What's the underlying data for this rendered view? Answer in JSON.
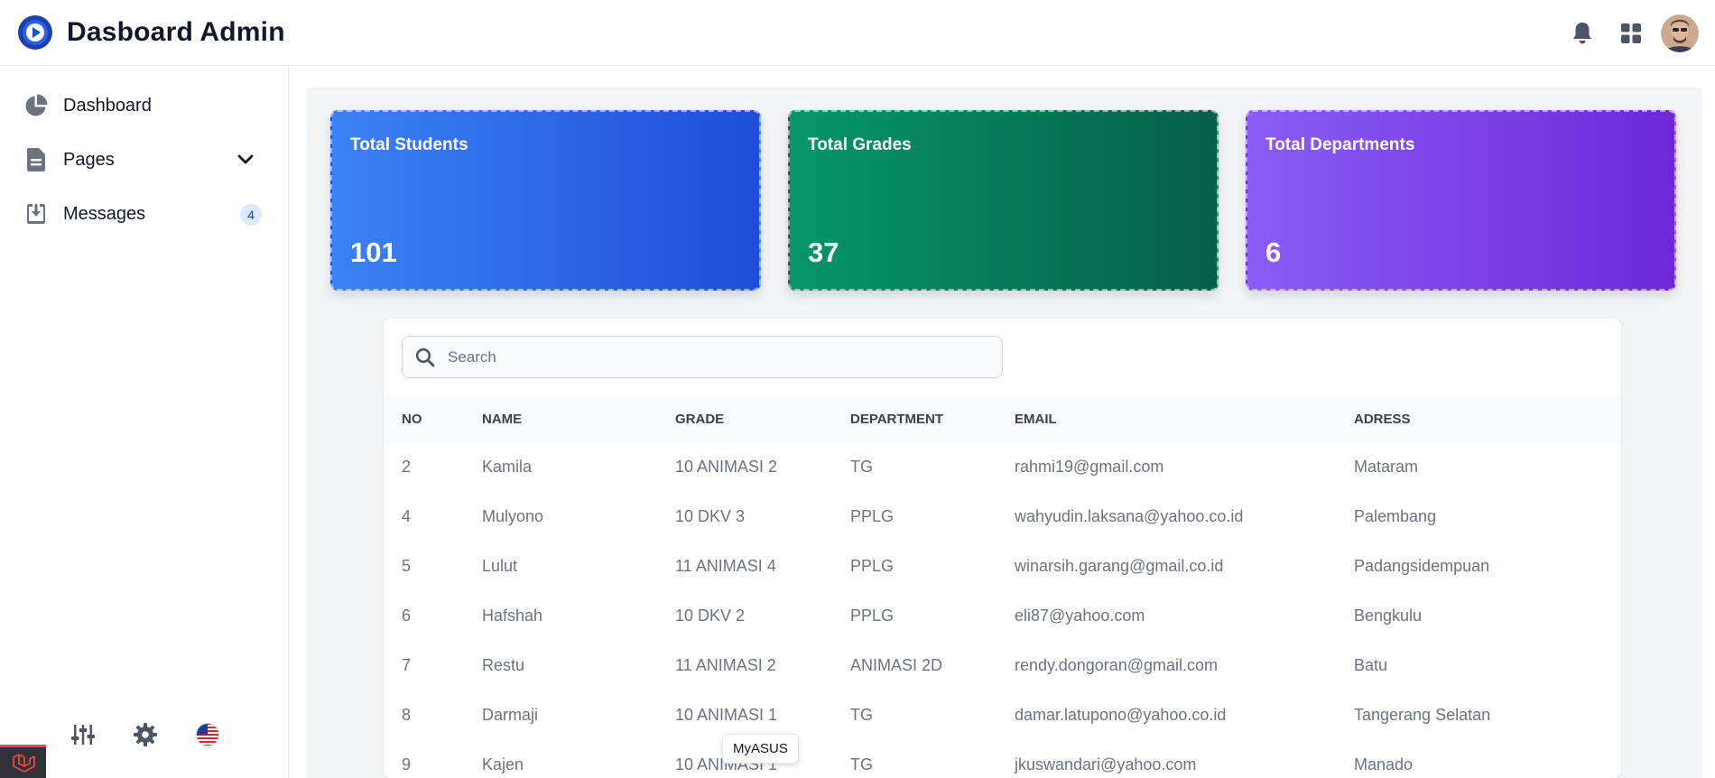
{
  "header": {
    "title": "Dasboard Admin",
    "logo_icon": "play-circle-icon",
    "actions": [
      {
        "icon": "bell-icon"
      },
      {
        "icon": "apps-grid-icon"
      },
      {
        "icon": "user-avatar"
      }
    ]
  },
  "sidebar": {
    "items": [
      {
        "label": "Dashboard",
        "icon": "pie-chart-icon"
      },
      {
        "label": "Pages",
        "icon": "document-icon",
        "expand_icon": "chevron-down-icon"
      },
      {
        "label": "Messages",
        "icon": "inbox-download-icon",
        "count": "4"
      }
    ],
    "bottom_tools": [
      "sliders-icon",
      "gear-icon",
      "us-flag-icon"
    ],
    "debug_tab_icon": "laravel-icon"
  },
  "cards": [
    {
      "title": "Total Students",
      "value": "101",
      "color": "#2563eb"
    },
    {
      "title": "Total Grades",
      "value": "37",
      "color": "#047857"
    },
    {
      "title": "Total Departments",
      "value": "6",
      "color": "#7c3aed"
    }
  ],
  "search": {
    "placeholder": "Search",
    "value": ""
  },
  "table": {
    "columns": [
      "NO",
      "NAME",
      "GRADE",
      "DEPARTMENT",
      "EMAIL",
      "ADRESS"
    ],
    "rows": [
      [
        "2",
        "Kamila",
        "10 ANIMASI 2",
        "TG",
        "rahmi19@gmail.com",
        "Mataram"
      ],
      [
        "4",
        "Mulyono",
        "10 DKV 3",
        "PPLG",
        "wahyudin.laksana@yahoo.co.id",
        "Palembang"
      ],
      [
        "5",
        "Lulut",
        "11 ANIMASI 4",
        "PPLG",
        "winarsih.garang@gmail.co.id",
        "Padangsidempuan"
      ],
      [
        "6",
        "Hafshah",
        "10 DKV 2",
        "PPLG",
        "eli87@yahoo.com",
        "Bengkulu"
      ],
      [
        "7",
        "Restu",
        "11 ANIMASI 2",
        "ANIMASI 2D",
        "rendy.dongoran@gmail.com",
        "Batu"
      ],
      [
        "8",
        "Darmaji",
        "10 ANIMASI 1",
        "TG",
        "damar.latupono@yahoo.co.id",
        "Tangerang Selatan"
      ],
      [
        "9",
        "Kajen",
        "10 ANIMASI 1",
        "TG",
        "jkuswandari@yahoo.com",
        "Manado"
      ]
    ]
  },
  "tooltip": {
    "text": "MyASUS"
  }
}
